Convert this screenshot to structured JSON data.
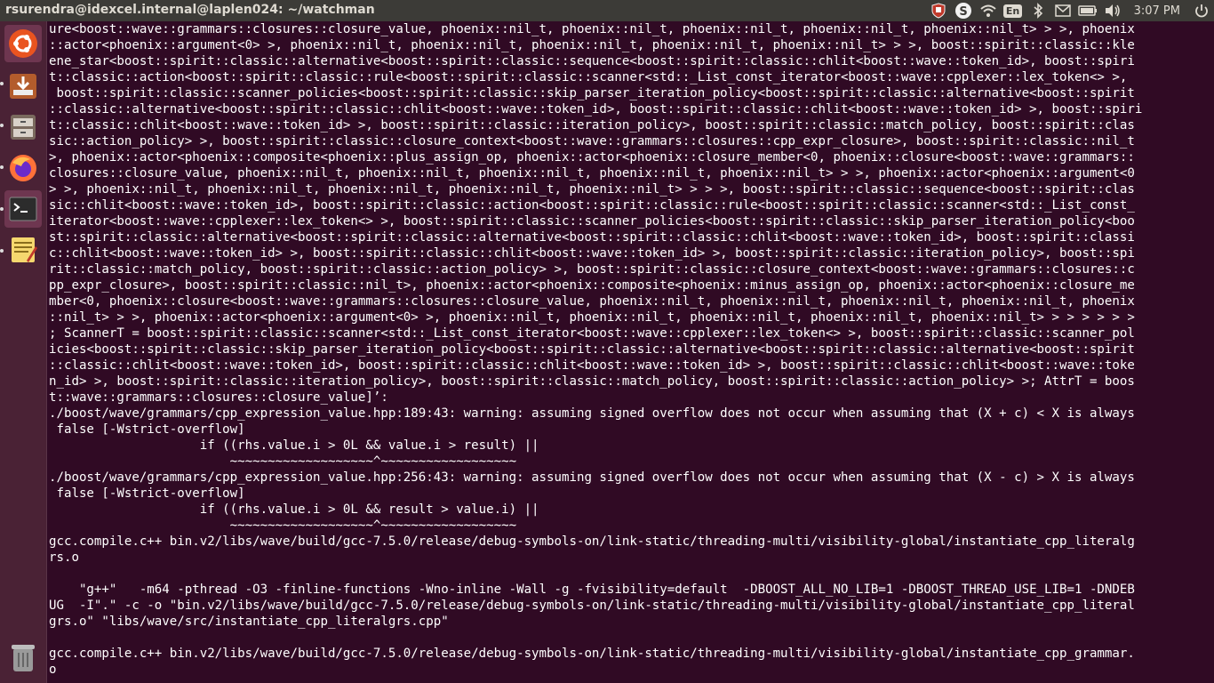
{
  "window": {
    "title": "rsurendra@idexcel.internal@laplen024: ~/watchman"
  },
  "tray": {
    "language": "En",
    "clock": "3:07 PM",
    "icons": [
      "shield-icon",
      "skype-icon",
      "wifi-icon",
      "keyboard-language-icon",
      "bluetooth-icon",
      "mail-icon",
      "battery-icon",
      "volume-icon",
      "power-icon"
    ]
  },
  "launcher": {
    "items": [
      "ubuntu-dash",
      "software-installer",
      "files",
      "firefox",
      "terminal",
      "text-editor",
      "trash"
    ]
  },
  "terminal": {
    "lines": [
      "ure<boost::wave::grammars::closures::closure_value, phoenix::nil_t, phoenix::nil_t, phoenix::nil_t, phoenix::nil_t, phoenix::nil_t> > >, phoenix",
      "::actor<phoenix::argument<0> >, phoenix::nil_t, phoenix::nil_t, phoenix::nil_t, phoenix::nil_t, phoenix::nil_t> > >, boost::spirit::classic::kle",
      "ene_star<boost::spirit::classic::alternative<boost::spirit::classic::sequence<boost::spirit::classic::chlit<boost::wave::token_id>, boost::spiri",
      "t::classic::action<boost::spirit::classic::rule<boost::spirit::classic::scanner<std::_List_const_iterator<boost::wave::cpplexer::lex_token<> >,",
      " boost::spirit::classic::scanner_policies<boost::spirit::classic::skip_parser_iteration_policy<boost::spirit::classic::alternative<boost::spirit",
      "::classic::alternative<boost::spirit::classic::chlit<boost::wave::token_id>, boost::spirit::classic::chlit<boost::wave::token_id> >, boost::spiri",
      "t::classic::chlit<boost::wave::token_id> >, boost::spirit::classic::iteration_policy>, boost::spirit::classic::match_policy, boost::spirit::clas",
      "sic::action_policy> >, boost::spirit::classic::closure_context<boost::wave::grammars::closures::cpp_expr_closure>, boost::spirit::classic::nil_t",
      ">, phoenix::actor<phoenix::composite<phoenix::plus_assign_op, phoenix::actor<phoenix::closure_member<0, phoenix::closure<boost::wave::grammars::",
      "closures::closure_value, phoenix::nil_t, phoenix::nil_t, phoenix::nil_t, phoenix::nil_t, phoenix::nil_t> > >, phoenix::actor<phoenix::argument<0",
      "> >, phoenix::nil_t, phoenix::nil_t, phoenix::nil_t, phoenix::nil_t, phoenix::nil_t> > > >, boost::spirit::classic::sequence<boost::spirit::clas",
      "sic::chlit<boost::wave::token_id>, boost::spirit::classic::action<boost::spirit::classic::rule<boost::spirit::classic::scanner<std::_List_const_",
      "iterator<boost::wave::cpplexer::lex_token<> >, boost::spirit::classic::scanner_policies<boost::spirit::classic::skip_parser_iteration_policy<boo",
      "st::spirit::classic::alternative<boost::spirit::classic::alternative<boost::spirit::classic::chlit<boost::wave::token_id>, boost::spirit::classi",
      "c::chlit<boost::wave::token_id> >, boost::spirit::classic::chlit<boost::wave::token_id> >, boost::spirit::classic::iteration_policy>, boost::spi",
      "rit::classic::match_policy, boost::spirit::classic::action_policy> >, boost::spirit::classic::closure_context<boost::wave::grammars::closures::c",
      "pp_expr_closure>, boost::spirit::classic::nil_t>, phoenix::actor<phoenix::composite<phoenix::minus_assign_op, phoenix::actor<phoenix::closure_me",
      "mber<0, phoenix::closure<boost::wave::grammars::closures::closure_value, phoenix::nil_t, phoenix::nil_t, phoenix::nil_t, phoenix::nil_t, phoenix",
      "::nil_t> > >, phoenix::actor<phoenix::argument<0> >, phoenix::nil_t, phoenix::nil_t, phoenix::nil_t, phoenix::nil_t, phoenix::nil_t> > > > > > >",
      "; ScannerT = boost::spirit::classic::scanner<std::_List_const_iterator<boost::wave::cpplexer::lex_token<> >, boost::spirit::classic::scanner_pol",
      "icies<boost::spirit::classic::skip_parser_iteration_policy<boost::spirit::classic::alternative<boost::spirit::classic::alternative<boost::spirit",
      "::classic::chlit<boost::wave::token_id>, boost::spirit::classic::chlit<boost::wave::token_id> >, boost::spirit::classic::chlit<boost::wave::toke",
      "n_id> >, boost::spirit::classic::iteration_policy>, boost::spirit::classic::match_policy, boost::spirit::classic::action_policy> >; AttrT = boos",
      "t::wave::grammars::closures::closure_value]’:",
      "./boost/wave/grammars/cpp_expression_value.hpp:189:43: warning: assuming signed overflow does not occur when assuming that (X + c) < X is always",
      " false [-Wstrict-overflow]",
      "                    if ((rhs.value.i > 0L && value.i > result) ||",
      "                        ~~~~~~~~~~~~~~~~~~~^~~~~~~~~~~~~~~~~~~",
      "./boost/wave/grammars/cpp_expression_value.hpp:256:43: warning: assuming signed overflow does not occur when assuming that (X - c) > X is always",
      " false [-Wstrict-overflow]",
      "                    if ((rhs.value.i > 0L && result > value.i) ||",
      "                        ~~~~~~~~~~~~~~~~~~~^~~~~~~~~~~~~~~~~~~",
      "gcc.compile.c++ bin.v2/libs/wave/build/gcc-7.5.0/release/debug-symbols-on/link-static/threading-multi/visibility-global/instantiate_cpp_literalg",
      "rs.o",
      "",
      "    \"g++\"   -m64 -pthread -O3 -finline-functions -Wno-inline -Wall -g -fvisibility=default  -DBOOST_ALL_NO_LIB=1 -DBOOST_THREAD_USE_LIB=1 -DNDEB",
      "UG  -I\".\" -c -o \"bin.v2/libs/wave/build/gcc-7.5.0/release/debug-symbols-on/link-static/threading-multi/visibility-global/instantiate_cpp_literal",
      "grs.o\" \"libs/wave/src/instantiate_cpp_literalgrs.cpp\"",
      "",
      "gcc.compile.c++ bin.v2/libs/wave/build/gcc-7.5.0/release/debug-symbols-on/link-static/threading-multi/visibility-global/instantiate_cpp_grammar.",
      "o"
    ]
  },
  "colors": {
    "terminal_bg": "#300a24",
    "terminal_fg": "#ffffff",
    "topbar_bg": "#3c3b37",
    "launcher_bg": "#4a2235"
  }
}
